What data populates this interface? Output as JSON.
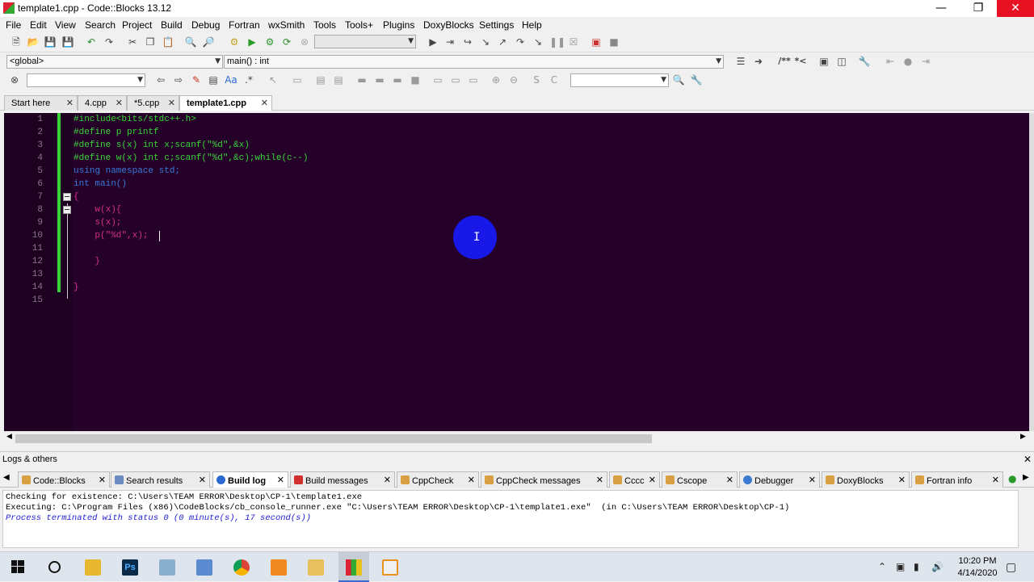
{
  "window": {
    "title": "template1.cpp - Code::Blocks 13.12"
  },
  "menu": [
    "File",
    "Edit",
    "View",
    "Search",
    "Project",
    "Build",
    "Debug",
    "Fortran",
    "wxSmith",
    "Tools",
    "Tools+",
    "Plugins",
    "DoxyBlocks",
    "Settings",
    "Help"
  ],
  "toolbar": {
    "scope_combo": "<global>",
    "function_combo": "main() : int",
    "search_combo": ""
  },
  "tabs": [
    {
      "label": "Start here",
      "active": false
    },
    {
      "label": "4.cpp",
      "active": false
    },
    {
      "label": "*5.cpp",
      "active": false
    },
    {
      "label": "template1.cpp",
      "active": true
    }
  ],
  "editor": {
    "line_numbers": [
      "1",
      "2",
      "3",
      "4",
      "5",
      "6",
      "7",
      "8",
      "9",
      "10",
      "11",
      "12",
      "13",
      "14",
      "15"
    ],
    "code": [
      "#include<bits/stdc++.h>",
      "#define p printf",
      "#define s(x) int x;scanf(\"%d\",&x)",
      "#define w(x) int c;scanf(\"%d\",&c);while(c--)",
      "using namespace std;",
      "int main()",
      "{",
      "    w(x){",
      "    s(x);",
      "    p(\"%d\",x);",
      "",
      "    }",
      "",
      "}",
      ""
    ],
    "cursor_glyph": "I"
  },
  "logs": {
    "title": "Logs & others",
    "tabs": [
      {
        "label": "Code::Blocks",
        "active": false,
        "color": "#d8a040"
      },
      {
        "label": "Search results",
        "active": false,
        "color": "#6a8ac0"
      },
      {
        "label": "Build log",
        "active": true,
        "color": "#2a6ad0"
      },
      {
        "label": "Build messages",
        "active": false,
        "color": "#d03030"
      },
      {
        "label": "CppCheck",
        "active": false,
        "color": "#d8a040"
      },
      {
        "label": "CppCheck messages",
        "active": false,
        "color": "#d8a040"
      },
      {
        "label": "Cccc",
        "active": false,
        "color": "#d8a040"
      },
      {
        "label": "Cscope",
        "active": false,
        "color": "#d8a040"
      },
      {
        "label": "Debugger",
        "active": false,
        "color": "#3a7ad0"
      },
      {
        "label": "DoxyBlocks",
        "active": false,
        "color": "#d8a040"
      },
      {
        "label": "Fortran info",
        "active": false,
        "color": "#d8a040"
      }
    ],
    "lines": [
      "Checking for existence: C:\\Users\\TEAM ERROR\\Desktop\\CP-1\\template1.exe",
      "Executing: C:\\Program Files (x86)\\CodeBlocks/cb_console_runner.exe \"C:\\Users\\TEAM ERROR\\Desktop\\CP-1\\template1.exe\"  (in C:\\Users\\TEAM ERROR\\Desktop\\CP-1)",
      "Process terminated with status 0 (0 minute(s), 17 second(s))"
    ]
  },
  "taskbar": {
    "time": "10:20 PM",
    "date": "4/14/2020"
  }
}
